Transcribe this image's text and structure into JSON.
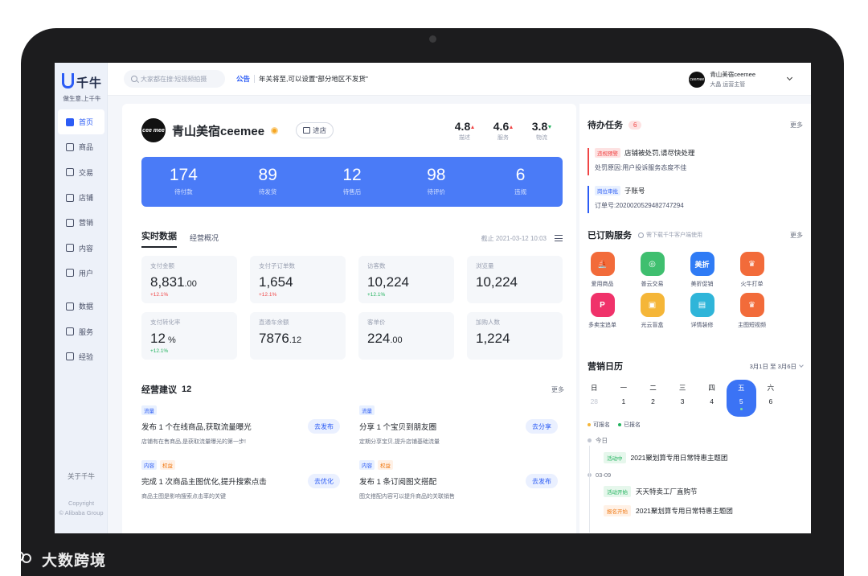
{
  "sidebar": {
    "logo": "千牛",
    "slogan": "做生意,上千牛",
    "items": [
      {
        "label": "首页",
        "icon": "home-icon"
      },
      {
        "label": "商品",
        "icon": "goods-icon"
      },
      {
        "label": "交易",
        "icon": "trade-icon"
      },
      {
        "label": "店铺",
        "icon": "store-icon"
      },
      {
        "label": "营销",
        "icon": "megaphone-icon"
      },
      {
        "label": "内容",
        "icon": "content-icon"
      },
      {
        "label": "用户",
        "icon": "user-icon"
      },
      {
        "label": "数据",
        "icon": "data-icon"
      },
      {
        "label": "服务",
        "icon": "service-icon"
      },
      {
        "label": "经验",
        "icon": "experience-icon"
      }
    ],
    "about": "关于千牛",
    "copyright_1": "Copyright",
    "copyright_2": "© Alibaba Group"
  },
  "topbar": {
    "search_placeholder": "大家都在搜:短视频拍摄",
    "notice_tag": "公告",
    "notice_text": "年关将至,可以设置\"部分地区不发货\"",
    "user_name": "青山美宿ceemee",
    "user_role": "大晶  运营主管",
    "avatar_text": "ceemee"
  },
  "shop": {
    "name": "青山美宿ceemee",
    "logo_text": "cee mee",
    "enter_label": "进店",
    "scores": [
      {
        "value": "4.8",
        "label": "描述",
        "trend": "up"
      },
      {
        "value": "4.6",
        "label": "服务",
        "trend": "up"
      },
      {
        "value": "3.8",
        "label": "物流",
        "trend": "down"
      }
    ]
  },
  "stats": [
    {
      "value": "174",
      "label": "待付款"
    },
    {
      "value": "89",
      "label": "待发货"
    },
    {
      "value": "12",
      "label": "待售后"
    },
    {
      "value": "98",
      "label": "待评价"
    },
    {
      "value": "6",
      "label": "违规"
    }
  ],
  "realtime": {
    "tab_active": "实时数据",
    "tab_other": "经营概况",
    "time": "截止 2021-03-12 10:03",
    "metrics": [
      {
        "label": "支付金额",
        "main": "8,831",
        "decimal": ".00",
        "delta": "+12.1%",
        "delta_color": "red"
      },
      {
        "label": "支付子订单数",
        "main": "1,654",
        "decimal": "",
        "delta": "+12.1%",
        "delta_color": "red"
      },
      {
        "label": "访客数",
        "main": "10,224",
        "decimal": "",
        "delta": "+12.1%",
        "delta_color": "green"
      },
      {
        "label": "浏览量",
        "main": "10,224",
        "decimal": "",
        "delta": "",
        "delta_color": ""
      },
      {
        "label": "支付转化率",
        "main": "12",
        "decimal": " %",
        "delta": "+12.1%",
        "delta_color": "green"
      },
      {
        "label": "直通车余额",
        "main": "7876",
        "decimal": ".12",
        "delta": "",
        "delta_color": ""
      },
      {
        "label": "客单价",
        "main": "224",
        "decimal": ".00",
        "delta": "",
        "delta_color": ""
      },
      {
        "label": "加购人数",
        "main": "1,224",
        "decimal": "",
        "delta": "",
        "delta_color": ""
      }
    ]
  },
  "advice": {
    "title": "经营建议",
    "count": "12",
    "more": "更多",
    "items": [
      {
        "tags": [
          "流量"
        ],
        "title": "发布 1 个在线商品,获取流量曝光",
        "desc": "店铺有在售商品,是获取流量曝光的第一步!",
        "button": "去发布"
      },
      {
        "tags": [
          "流量"
        ],
        "title": "分享 1 个宝贝到朋友圈",
        "desc": "定期分享宝贝,提升店铺基础流量",
        "button": "去分享"
      },
      {
        "tags": [
          "内容",
          "权益"
        ],
        "title": "完成 1 次商品主图优化,提升搜索点击",
        "desc": "商品主图是影响搜索点击率的关键",
        "button": "去优化"
      },
      {
        "tags": [
          "内容",
          "权益"
        ],
        "title": "发布 1 条订阅图文搭配",
        "desc": "图文搭配内容可以提升商品的关联销售",
        "button": "去发布"
      }
    ]
  },
  "todo": {
    "title": "待办任务",
    "count": "6",
    "more": "更多",
    "items": [
      {
        "tag": "违规预警",
        "title": "店铺被处罚,请尽快处理",
        "detail": "处罚原因:用户投诉服务态度不佳",
        "color": "#f04545",
        "tag_bg": "#fde2e2"
      },
      {
        "tag": "岗位审批",
        "title": "子账号",
        "detail": "订单号:2020020529482747294",
        "color": "#2c5cf5",
        "tag_bg": "#e8f0ff"
      }
    ]
  },
  "services": {
    "title": "已订购服务",
    "note": "需下载千牛客户端使用",
    "more": "更多",
    "items": [
      {
        "label": "爱用商品",
        "color": "#f26b3a",
        "glyph": "⛵",
        "icon": "aiyong-goods-icon"
      },
      {
        "label": "普云交易",
        "color": "#3fbf6f",
        "glyph": "◎",
        "icon": "puyun-trade-icon"
      },
      {
        "label": "美折促销",
        "color": "#2f7bf5",
        "glyph": "美折",
        "icon": "meizhe-promo-icon"
      },
      {
        "label": "火牛打单",
        "color": "#f26b3a",
        "glyph": "♛",
        "icon": "huoniu-print-icon"
      },
      {
        "label": "多卖宝追单",
        "color": "#f0326a",
        "glyph": "P",
        "icon": "duomaibao-icon"
      },
      {
        "label": "光云盲盒",
        "color": "#f5b638",
        "glyph": "▣",
        "icon": "guangyun-box-icon"
      },
      {
        "label": "详情装修",
        "color": "#2fb5d9",
        "glyph": "▤",
        "icon": "detail-decor-icon"
      },
      {
        "label": "主图短视频",
        "color": "#f26b3a",
        "glyph": "♛",
        "icon": "main-video-icon"
      }
    ]
  },
  "calendar": {
    "title": "营销日历",
    "range": "3月1日 至 3月6日",
    "days": [
      {
        "weekday": "日",
        "date": "28",
        "muted": true,
        "active": false
      },
      {
        "weekday": "一",
        "date": "1",
        "muted": false,
        "active": false
      },
      {
        "weekday": "二",
        "date": "2",
        "muted": false,
        "active": false
      },
      {
        "weekday": "三",
        "date": "3",
        "muted": false,
        "active": false
      },
      {
        "weekday": "四",
        "date": "4",
        "muted": false,
        "active": false
      },
      {
        "weekday": "五",
        "date": "5",
        "muted": false,
        "active": true
      },
      {
        "weekday": "六",
        "date": "6",
        "muted": false,
        "active": false
      }
    ],
    "legend": [
      {
        "label": "可报名",
        "color": "#f5b638"
      },
      {
        "label": "已报名",
        "color": "#22b35e"
      }
    ],
    "timeline": [
      {
        "date": "今日",
        "events": [
          {
            "tag": "活动中",
            "tag_type": "green",
            "title": "2021聚划算专用日常特惠主题团"
          }
        ]
      },
      {
        "date": "03-09",
        "events": [
          {
            "tag": "活动开始",
            "tag_type": "green",
            "title": "天天特卖工厂直购节"
          },
          {
            "tag": "报名开始",
            "tag_type": "orange",
            "title": "2021聚划算专用日常特惠主题团"
          }
        ]
      }
    ]
  },
  "watermark": "大数跨境",
  "colors": {
    "accent": "#2c5cf5",
    "stat_bar": "#4a7bf7",
    "up": "#f04545",
    "down": "#22b35e"
  }
}
